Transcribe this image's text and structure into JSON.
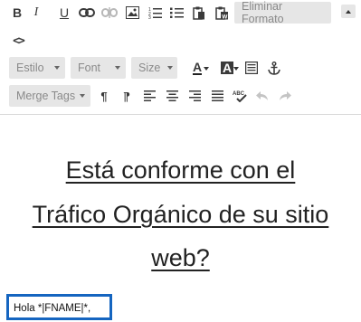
{
  "toolbar": {
    "row1": {
      "bold_icon": "bold-icon",
      "italic_icon": "italic-icon",
      "underline_icon": "underline-icon",
      "link_icon": "link-icon",
      "unlink_icon": "unlink-icon",
      "image_icon": "image-icon",
      "ordered_list_icon": "ordered-list-icon",
      "unordered_list_icon": "unordered-list-icon",
      "paste_icon": "paste-icon",
      "paste_word_icon": "paste-word-icon",
      "remove_format_label": "Eliminar Formato",
      "toggle_icon": "collapse-toolbar-icon"
    },
    "row2": {
      "code_label": "<>"
    },
    "row3": {
      "style_label": "Estilo",
      "font_label": "Font",
      "size_label": "Size",
      "text_color_label": "A",
      "bg_color_label": "A",
      "table_icon": "table-icon",
      "anchor_icon": "anchor-icon"
    },
    "row4": {
      "merge_tags_label": "Merge Tags",
      "paragraph_label": "¶",
      "rtl_paragraph_label": "¶",
      "align_left_icon": "align-left-icon",
      "align_center_icon": "align-center-icon",
      "align_right_icon": "align-right-icon",
      "align_justify_icon": "align-justify-icon",
      "spellcheck_icon": "spellcheck-icon",
      "undo_icon": "undo-icon",
      "redo_icon": "redo-icon"
    }
  },
  "content": {
    "heading_lines": [
      "Está conforme con el ",
      "Tráfico Orgánico de su sitio",
      "web?"
    ],
    "greeting": "Hola *|FNAME|*,"
  },
  "colors": {
    "button_bg": "#e6e6e6",
    "focus_border": "#1565c0",
    "text": "#222222"
  }
}
